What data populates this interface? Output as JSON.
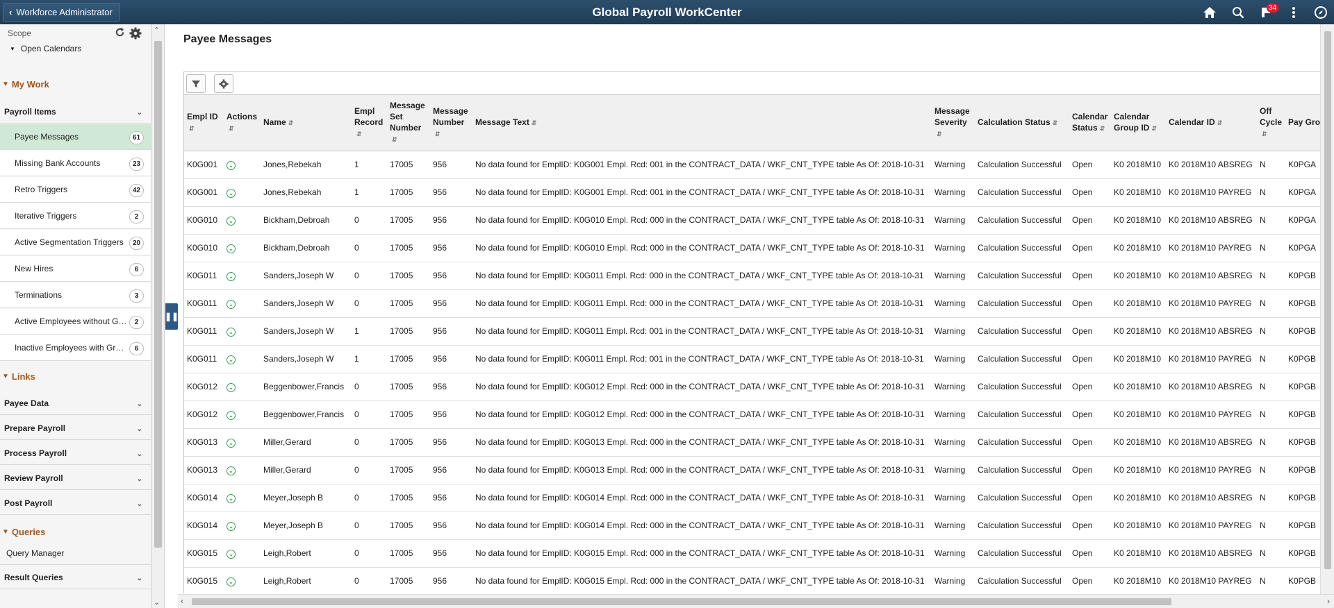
{
  "topbar": {
    "back_label": "Workforce Administrator",
    "title": "Global Payroll WorkCenter",
    "notification_count": "34"
  },
  "sidebar": {
    "scope_label": "Scope",
    "open_calendars": "Open Calendars",
    "my_work": "My Work",
    "payroll_items_label": "Payroll Items",
    "items": [
      {
        "label": "Payee Messages",
        "count": "61"
      },
      {
        "label": "Missing Bank Accounts",
        "count": "23"
      },
      {
        "label": "Retro Triggers",
        "count": "42"
      },
      {
        "label": "Iterative Triggers",
        "count": "2"
      },
      {
        "label": "Active Segmentation Triggers",
        "count": "20"
      },
      {
        "label": "New Hires",
        "count": "6"
      },
      {
        "label": "Terminations",
        "count": "3"
      },
      {
        "label": "Active Employees without Gr...",
        "count": "2"
      },
      {
        "label": "Inactive Employees with Gro...",
        "count": "6"
      }
    ],
    "links": "Links",
    "link_groups": [
      "Payee Data",
      "Prepare Payroll",
      "Process Payroll",
      "Review Payroll",
      "Post Payroll"
    ],
    "queries": "Queries",
    "query_manager": "Query Manager",
    "result_queries": "Result Queries"
  },
  "main": {
    "title": "Payee Messages",
    "columns": [
      {
        "label": "Empl ID"
      },
      {
        "label": "Actions"
      },
      {
        "label": "Name"
      },
      {
        "label": "Empl Record"
      },
      {
        "label": "Message Set Number"
      },
      {
        "label": "Message Number"
      },
      {
        "label": "Message Text"
      },
      {
        "label": "Message Severity"
      },
      {
        "label": "Calculation Status"
      },
      {
        "label": "Calendar Status"
      },
      {
        "label": "Calendar Group ID"
      },
      {
        "label": "Calendar ID"
      },
      {
        "label": "Off Cycle"
      },
      {
        "label": "Pay Group"
      }
    ],
    "rows": [
      [
        "K0G001",
        "Jones,Rebekah",
        "1",
        "17005",
        "956",
        "No data found for EmplID: K0G001 Empl. Rcd: 001 in the CONTRACT_DATA / WKF_CNT_TYPE table As Of: 2018-10-31",
        "Warning",
        "Calculation Successful",
        "Open",
        "K0 2018M10",
        "K0 2018M10 ABSREG",
        "N",
        "K0PGA"
      ],
      [
        "K0G001",
        "Jones,Rebekah",
        "1",
        "17005",
        "956",
        "No data found for EmplID: K0G001 Empl. Rcd: 001 in the CONTRACT_DATA / WKF_CNT_TYPE table As Of: 2018-10-31",
        "Warning",
        "Calculation Successful",
        "Open",
        "K0 2018M10",
        "K0 2018M10 PAYREG",
        "N",
        "K0PGA"
      ],
      [
        "K0G010",
        "Bickham,Debroah",
        "0",
        "17005",
        "956",
        "No data found for EmplID: K0G010 Empl. Rcd: 000 in the CONTRACT_DATA / WKF_CNT_TYPE table As Of: 2018-10-31",
        "Warning",
        "Calculation Successful",
        "Open",
        "K0 2018M10",
        "K0 2018M10 ABSREG",
        "N",
        "K0PGA"
      ],
      [
        "K0G010",
        "Bickham,Debroah",
        "0",
        "17005",
        "956",
        "No data found for EmplID: K0G010 Empl. Rcd: 000 in the CONTRACT_DATA / WKF_CNT_TYPE table As Of: 2018-10-31",
        "Warning",
        "Calculation Successful",
        "Open",
        "K0 2018M10",
        "K0 2018M10 PAYREG",
        "N",
        "K0PGA"
      ],
      [
        "K0G011",
        "Sanders,Joseph W",
        "0",
        "17005",
        "956",
        "No data found for EmplID: K0G011 Empl. Rcd: 000 in the CONTRACT_DATA / WKF_CNT_TYPE table As Of: 2018-10-31",
        "Warning",
        "Calculation Successful",
        "Open",
        "K0 2018M10",
        "K0 2018M10 ABSREG",
        "N",
        "K0PGB"
      ],
      [
        "K0G011",
        "Sanders,Joseph W",
        "0",
        "17005",
        "956",
        "No data found for EmplID: K0G011 Empl. Rcd: 000 in the CONTRACT_DATA / WKF_CNT_TYPE table As Of: 2018-10-31",
        "Warning",
        "Calculation Successful",
        "Open",
        "K0 2018M10",
        "K0 2018M10 PAYREG",
        "N",
        "K0PGB"
      ],
      [
        "K0G011",
        "Sanders,Joseph W",
        "1",
        "17005",
        "956",
        "No data found for EmplID: K0G011 Empl. Rcd: 001 in the CONTRACT_DATA / WKF_CNT_TYPE table As Of: 2018-10-31",
        "Warning",
        "Calculation Successful",
        "Open",
        "K0 2018M10",
        "K0 2018M10 ABSREG",
        "N",
        "K0PGB"
      ],
      [
        "K0G011",
        "Sanders,Joseph W",
        "1",
        "17005",
        "956",
        "No data found for EmplID: K0G011 Empl. Rcd: 001 in the CONTRACT_DATA / WKF_CNT_TYPE table As Of: 2018-10-31",
        "Warning",
        "Calculation Successful",
        "Open",
        "K0 2018M10",
        "K0 2018M10 PAYREG",
        "N",
        "K0PGB"
      ],
      [
        "K0G012",
        "Beggenbower,Francis",
        "0",
        "17005",
        "956",
        "No data found for EmplID: K0G012 Empl. Rcd: 000 in the CONTRACT_DATA / WKF_CNT_TYPE table As Of: 2018-10-31",
        "Warning",
        "Calculation Successful",
        "Open",
        "K0 2018M10",
        "K0 2018M10 ABSREG",
        "N",
        "K0PGB"
      ],
      [
        "K0G012",
        "Beggenbower,Francis",
        "0",
        "17005",
        "956",
        "No data found for EmplID: K0G012 Empl. Rcd: 000 in the CONTRACT_DATA / WKF_CNT_TYPE table As Of: 2018-10-31",
        "Warning",
        "Calculation Successful",
        "Open",
        "K0 2018M10",
        "K0 2018M10 PAYREG",
        "N",
        "K0PGB"
      ],
      [
        "K0G013",
        "Miller,Gerard",
        "0",
        "17005",
        "956",
        "No data found for EmplID: K0G013 Empl. Rcd: 000 in the CONTRACT_DATA / WKF_CNT_TYPE table As Of: 2018-10-31",
        "Warning",
        "Calculation Successful",
        "Open",
        "K0 2018M10",
        "K0 2018M10 ABSREG",
        "N",
        "K0PGB"
      ],
      [
        "K0G013",
        "Miller,Gerard",
        "0",
        "17005",
        "956",
        "No data found for EmplID: K0G013 Empl. Rcd: 000 in the CONTRACT_DATA / WKF_CNT_TYPE table As Of: 2018-10-31",
        "Warning",
        "Calculation Successful",
        "Open",
        "K0 2018M10",
        "K0 2018M10 PAYREG",
        "N",
        "K0PGB"
      ],
      [
        "K0G014",
        "Meyer,Joseph B",
        "0",
        "17005",
        "956",
        "No data found for EmplID: K0G014 Empl. Rcd: 000 in the CONTRACT_DATA / WKF_CNT_TYPE table As Of: 2018-10-31",
        "Warning",
        "Calculation Successful",
        "Open",
        "K0 2018M10",
        "K0 2018M10 ABSREG",
        "N",
        "K0PGB"
      ],
      [
        "K0G014",
        "Meyer,Joseph B",
        "0",
        "17005",
        "956",
        "No data found for EmplID: K0G014 Empl. Rcd: 000 in the CONTRACT_DATA / WKF_CNT_TYPE table As Of: 2018-10-31",
        "Warning",
        "Calculation Successful",
        "Open",
        "K0 2018M10",
        "K0 2018M10 PAYREG",
        "N",
        "K0PGB"
      ],
      [
        "K0G015",
        "Leigh,Robert",
        "0",
        "17005",
        "956",
        "No data found for EmplID: K0G015 Empl. Rcd: 000 in the CONTRACT_DATA / WKF_CNT_TYPE table As Of: 2018-10-31",
        "Warning",
        "Calculation Successful",
        "Open",
        "K0 2018M10",
        "K0 2018M10 ABSREG",
        "N",
        "K0PGB"
      ],
      [
        "K0G015",
        "Leigh,Robert",
        "0",
        "17005",
        "956",
        "No data found for EmplID: K0G015 Empl. Rcd: 000 in the CONTRACT_DATA / WKF_CNT_TYPE table As Of: 2018-10-31",
        "Warning",
        "Calculation Successful",
        "Open",
        "K0 2018M10",
        "K0 2018M10 PAYREG",
        "N",
        "K0PGB"
      ]
    ]
  },
  "colors": {
    "header_bg": "#213d57",
    "section_accent": "#a3561d",
    "active_item_bg": "#cfe9d6",
    "action_icon": "#2f9e57",
    "badge_red": "#e0202b"
  }
}
